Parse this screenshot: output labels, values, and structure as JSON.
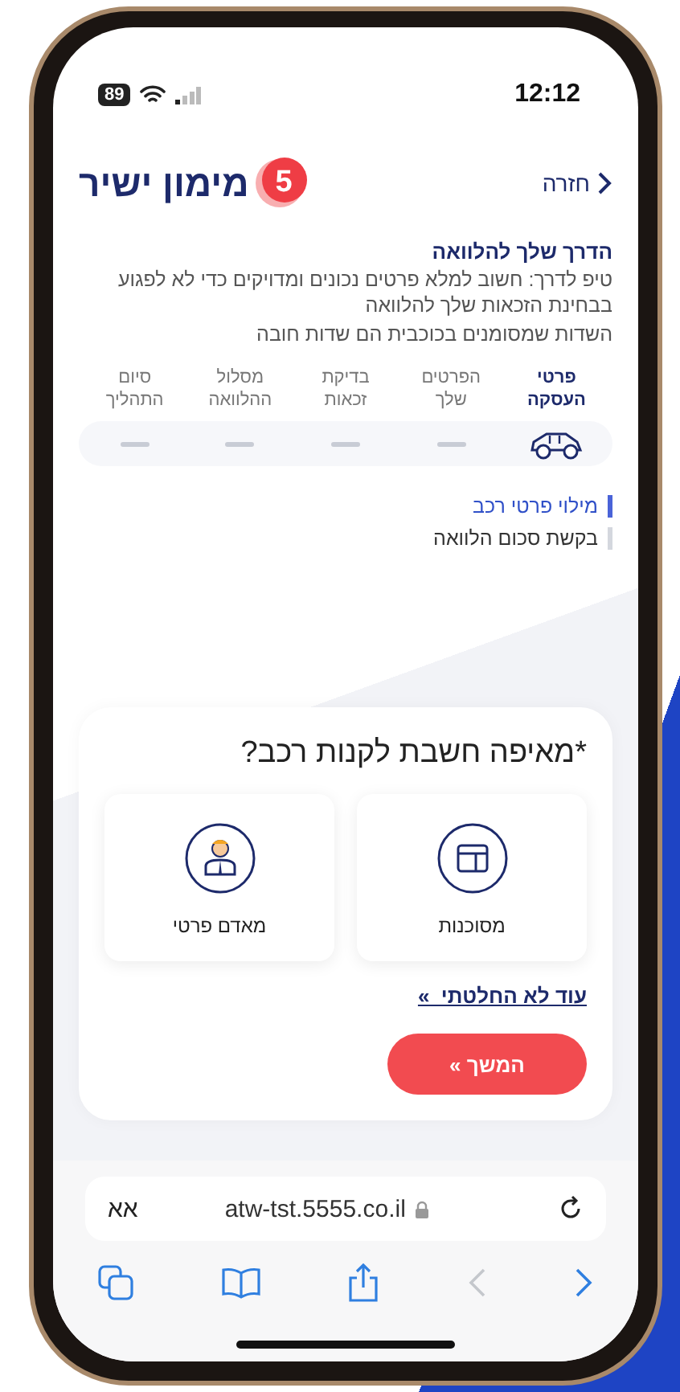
{
  "status_bar": {
    "time": "12:12",
    "battery": "89"
  },
  "header": {
    "back_label": "חזרה",
    "logo_text": "מימון ישיר",
    "logo_number": "5"
  },
  "intro": {
    "title": "הדרך שלך להלוואה",
    "tip": "טיפ לדרך: חשוב למלא פרטים נכונים ומדויקים כדי לא לפגוע בבחינת הזכאות שלך להלוואה",
    "required_note": "השדות שמסומנים בכוכבית הם שדות חובה"
  },
  "steps": [
    {
      "label": "פרטי העסקה",
      "selected": true
    },
    {
      "label": "הפרטים שלך",
      "selected": false
    },
    {
      "label": "בדיקת זכאות",
      "selected": false
    },
    {
      "label": "מסלול ההלוואה",
      "selected": false
    },
    {
      "label": "סיום התהליך",
      "selected": false
    }
  ],
  "sub_steps": [
    {
      "label": "מילוי פרטי רכב",
      "selected": true
    },
    {
      "label": "בקשת סכום הלוואה",
      "selected": false
    }
  ],
  "question": {
    "title": "*מאיפה חשבת לקנות רכב?",
    "options": [
      {
        "label": "מסוכנות",
        "kind": "store",
        "selected": false
      },
      {
        "label": "מאדם פרטי",
        "kind": "person",
        "selected": false
      }
    ],
    "undecided_link": "עוד לא החלטתי  »",
    "next_button": "המשך »"
  },
  "browser": {
    "text_size": "אא",
    "url": "atw-tst.5555.co.il",
    "toolbar": [
      {
        "kind": "tabs",
        "disabled": false
      },
      {
        "kind": "bookmarks",
        "disabled": false
      },
      {
        "kind": "share",
        "disabled": false
      },
      {
        "kind": "back",
        "disabled": true
      },
      {
        "kind": "forward",
        "disabled": false
      }
    ]
  }
}
